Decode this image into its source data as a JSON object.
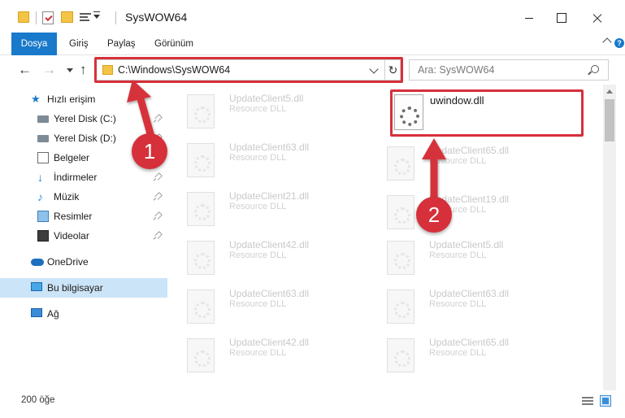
{
  "window": {
    "title": "SysWOW64",
    "minimize_label": "",
    "maximize_label": "",
    "close_label": ""
  },
  "ribbon": {
    "tabs": [
      "Dosya",
      "Giriş",
      "Paylaş",
      "Görünüm"
    ],
    "help": "?"
  },
  "nav": {
    "back": "←",
    "forward": "→",
    "up": "↑",
    "refresh": "↻",
    "address": "C:\\Windows\\SysWOW64",
    "search_placeholder": "Ara: SysWOW64"
  },
  "sidebar": {
    "items": [
      {
        "label": "Hızlı erişim",
        "icon": "star-icon"
      },
      {
        "label": "Yerel Disk (C:)",
        "icon": "disk-icon"
      },
      {
        "label": "Yerel Disk (D:)",
        "icon": "disk-icon"
      },
      {
        "label": "Belgeler",
        "icon": "documents-icon"
      },
      {
        "label": "İndirmeler",
        "icon": "downloads-icon"
      },
      {
        "label": "Müzik",
        "icon": "music-icon"
      },
      {
        "label": "Resimler",
        "icon": "pictures-icon"
      },
      {
        "label": "Videolar",
        "icon": "videos-icon"
      },
      {
        "label": "OneDrive",
        "icon": "cloud-icon"
      },
      {
        "label": "Bu bilgisayar",
        "icon": "computer-icon"
      },
      {
        "label": "Ağ",
        "icon": "network-icon"
      }
    ]
  },
  "files": {
    "featured": {
      "name": "uwindow.dll"
    },
    "left_column": [
      {
        "name": "UpdateClient5.dll",
        "type": "Resource DLL"
      },
      {
        "name": "UpdateClient63.dll",
        "type": "Resource DLL"
      },
      {
        "name": "UpdateClient21.dll",
        "type": "Resource DLL"
      },
      {
        "name": "UpdateClient42.dll",
        "type": "Resource DLL"
      },
      {
        "name": "UpdateClient63.dll",
        "type": "Resource DLL"
      },
      {
        "name": "UpdateClient42.dll",
        "type": "Resource DLL"
      }
    ],
    "right_column": [
      {
        "name": "UpdateClient65.dll",
        "type": "Resource DLL"
      },
      {
        "name": "UpdateClient19.dll",
        "type": "Resource DLL"
      },
      {
        "name": "UpdateClient5.dll",
        "type": "Resource DLL"
      },
      {
        "name": "UpdateClient63.dll",
        "type": "Resource DLL"
      },
      {
        "name": "UpdateClient65.dll",
        "type": "Resource DLL"
      }
    ]
  },
  "status": {
    "item_count": "200 öğe"
  },
  "annotations": {
    "step1": "1",
    "step2": "2",
    "highlight_color": "#d6303b"
  },
  "colors": {
    "accent": "#1979ca",
    "selection": "#cce4f7"
  }
}
